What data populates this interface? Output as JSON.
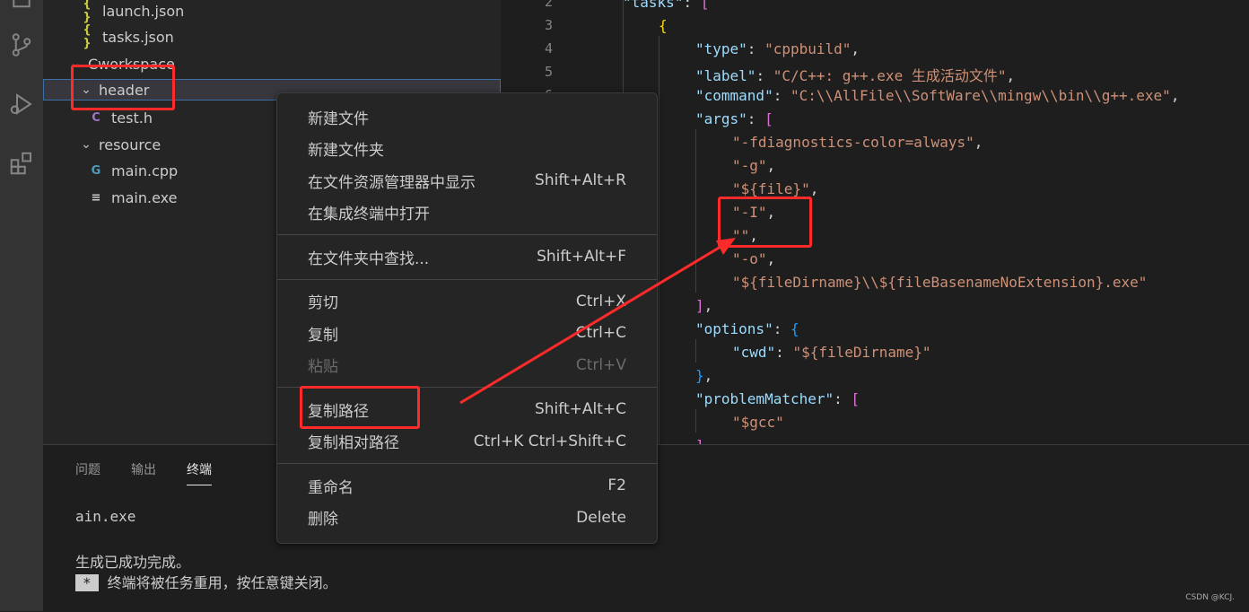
{
  "explorer": {
    "items": [
      {
        "icon": "{ }",
        "label": "launch.json"
      },
      {
        "icon": "{ }",
        "label": "tasks.json"
      },
      {
        "label": "Cworkspace"
      },
      {
        "label": "header"
      },
      {
        "icon": "C",
        "label": "test.h"
      },
      {
        "label": "resource"
      },
      {
        "icon": "G",
        "label": "main.cpp"
      },
      {
        "icon": "≡",
        "label": "main.exe"
      }
    ]
  },
  "editor": {
    "line_numbers": [
      "2",
      "3",
      "4",
      "5",
      "6"
    ],
    "lines": [
      {
        "k": "\"tasks\"",
        "p": ": ",
        "b": "["
      },
      {
        "b": "{"
      },
      {
        "k": "\"type\"",
        "p": ": ",
        "s": "\"cppbuild\"",
        "t": ","
      },
      {
        "k": "\"label\"",
        "p": ": ",
        "s": "\"C/C++: g++.exe 生成活动文件\"",
        "t": ","
      },
      {
        "k": "\"command\"",
        "p": ": ",
        "s": "\"C:\\\\AllFile\\\\SoftWare\\\\mingw\\\\bin\\\\g++.exe\"",
        "t": ","
      },
      {
        "k": "\"args\"",
        "p": ": ",
        "b": "["
      },
      {
        "s": "\"-fdiagnostics-color=always\"",
        "t": ","
      },
      {
        "s": "\"-g\"",
        "t": ","
      },
      {
        "s": "\"${file}\"",
        "t": ","
      },
      {
        "s": "\"-I\"",
        "t": ","
      },
      {
        "s": "\"\"",
        "t": ","
      },
      {
        "s": "\"-o\"",
        "t": ","
      },
      {
        "s": "\"${fileDirname}\\\\${fileBasenameNoExtension}.exe\""
      },
      {
        "b": "]",
        "t": ","
      },
      {
        "k": "\"options\"",
        "p": ": ",
        "b": "{"
      },
      {
        "k": "\"cwd\"",
        "p": ": ",
        "s": "\"${fileDirname}\""
      },
      {
        "b": "}",
        "t": ","
      },
      {
        "k": "\"problemMatcher\"",
        "p": ": ",
        "b": "["
      },
      {
        "s": "\"$gcc\""
      },
      {
        "b": "]"
      }
    ]
  },
  "panel": {
    "tabs": [
      "问题",
      "输出",
      "终端"
    ],
    "active_tab": "终端",
    "terminal_lines": [
      "ain.exe",
      "生成已成功完成。",
      "终端将被任务重用，按任意键关闭。"
    ],
    "badge": "*"
  },
  "context_menu": {
    "groups": [
      [
        {
          "label": "新建文件",
          "shortcut": ""
        },
        {
          "label": "新建文件夹",
          "shortcut": ""
        },
        {
          "label": "在文件资源管理器中显示",
          "shortcut": "Shift+Alt+R"
        },
        {
          "label": "在集成终端中打开",
          "shortcut": ""
        }
      ],
      [
        {
          "label": "在文件夹中查找...",
          "shortcut": "Shift+Alt+F"
        }
      ],
      [
        {
          "label": "剪切",
          "shortcut": "Ctrl+X"
        },
        {
          "label": "复制",
          "shortcut": "Ctrl+C"
        },
        {
          "label": "粘贴",
          "shortcut": "Ctrl+V",
          "disabled": true
        }
      ],
      [
        {
          "label": "复制路径",
          "shortcut": "Shift+Alt+C"
        },
        {
          "label": "复制相对路径",
          "shortcut": "Ctrl+K Ctrl+Shift+C"
        }
      ],
      [
        {
          "label": "重命名",
          "shortcut": "F2"
        },
        {
          "label": "删除",
          "shortcut": "Delete"
        }
      ]
    ]
  },
  "watermark": "CSDN @KCJ.",
  "colors": {
    "annotation": "#ff2a2a",
    "accent": "#3b6fa8"
  }
}
